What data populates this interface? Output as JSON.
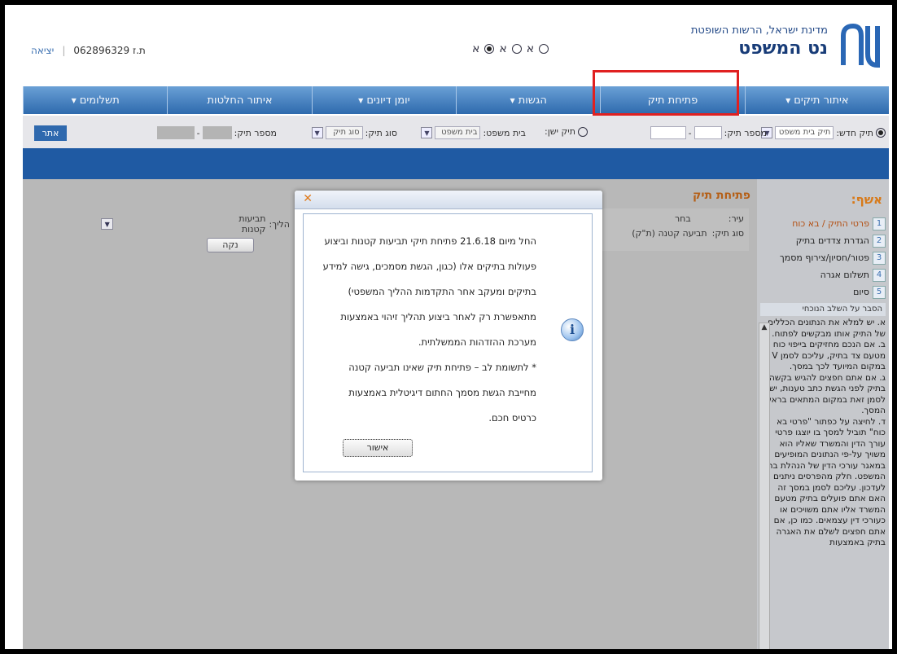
{
  "header": {
    "org_line1": "מדינת ישראל, הרשות השופטת",
    "org_line2": "נט המשפט",
    "radio_label": "א",
    "user_id": "ת.ז 062896329",
    "exit_label": "יציאה"
  },
  "nav": {
    "tabs": [
      {
        "label": "איתור תיקים",
        "caret": true
      },
      {
        "label": "פתיחת תיק",
        "caret": false
      },
      {
        "label": "הגשות",
        "caret": true
      },
      {
        "label": "יומן דיונים",
        "caret": true
      },
      {
        "label": "איתור החלטות",
        "caret": false
      },
      {
        "label": "תשלומים",
        "caret": true
      }
    ]
  },
  "filter": {
    "new_case_label": "תיק חדש:",
    "new_case_select": "תיק בית משפט",
    "case_number_label": "מספר תיק:",
    "old_case_label": "תיק ישן:",
    "court_label": "בית משפט:",
    "court_value": "בית משפט",
    "case_type_label": "סוג תיק:",
    "case_type_value": "סוג תיק",
    "case_number_label2": "מספר תיק:",
    "go_label": "אתר"
  },
  "sidebar": {
    "title": "אשף:",
    "steps": [
      {
        "num": "1",
        "label": "פרטי התיק / בא כוח"
      },
      {
        "num": "2",
        "label": "הגדרת צדדים בתיק"
      },
      {
        "num": "3",
        "label": "פטור/חסיון/צירוף מסמך"
      },
      {
        "num": "4",
        "label": "תשלום אגרה"
      },
      {
        "num": "5",
        "label": "סיום"
      }
    ],
    "explain_header": "הסבר על השלב הנוכחי",
    "explain_text": [
      "א. יש למלא את הנתונים הכללים של התיק אותו מבקשים לפתוח.",
      "ב. אם הנכם מחזיקים בייפוי כוח מטעם צד בתיק, עליכם לסמן V במקום המיועד לכך במסך.",
      "ג. אם אתם חפצים להגיש בקשה בתיק לפני הגשת כתב טענות, יש לסמן זאת במקום המתאים בראש המסך.",
      "ד. לחיצה על כפתור \"פרטי בא כוח\" תוביל למסך בו יוצגו פרטי עורך הדין והמשרד שאליו הוא משויך על-פי הנתונים המופיעים במאגר עורכי הדין של הנהלת בתי המשפט. חלק מהפרסים ניתנים לעדכון. עליכם לסמן במסך זה האם אתם פועלים בתיק מטעם המשרד אליו אתם משויכים או כעורכי דין עצמאים. כמו כן, אם אתם חפצים לשלם את האגרה בתיק באמצעות"
    ]
  },
  "content": {
    "title": "פתיחת תיק",
    "city_label": "עיר:",
    "city_value": "בחר",
    "case_type_label": "סוג תיק:",
    "case_type_value": "תביעה קטנה (ת\"ק)",
    "procedure_label": "הליך:",
    "procedure_value": "תביעות קטנות",
    "clear_label": "נקה"
  },
  "modal": {
    "lines": [
      "החל מיום 21.6.18 פתיחת תיקי תביעות קטנות וביצוע",
      "פעולות בתיקים אלו (כגון, הגשת מסמכים, גישה למידע",
      "בתיקים ומעקב אחר התקדמות ההליך המשפטי)",
      "מתאפשרת רק לאחר ביצוע תהליך זיהוי באמצעות",
      "מערכת ההזדהות הממשלתית.",
      "* לתשומת לב – פתיחת תיק שאינו תביעה קטנה",
      "מחייבת הגשת מסמך החתום דיגיטלית באמצעות",
      "כרטיס חכם."
    ],
    "ok_label": "אישור",
    "close_glyph": "✕",
    "info_glyph": "i"
  },
  "colors": {
    "nav_top": "#6aa0d6",
    "nav_bottom": "#2e6aad",
    "highlight_box": "#e02020",
    "title_orange": "#b56018"
  }
}
